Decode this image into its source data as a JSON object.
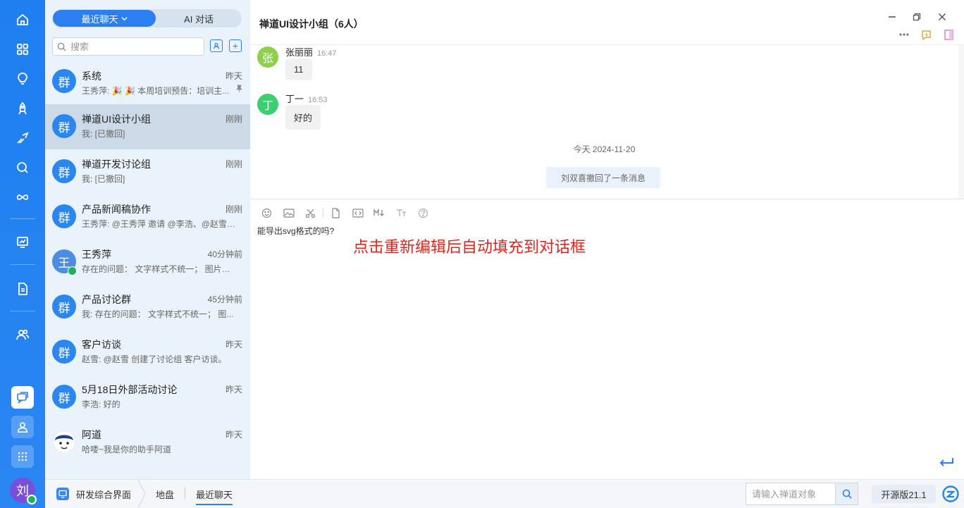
{
  "sidebar": {
    "icons": [
      "home-icon",
      "apps-grid-icon",
      "lightbulb-icon",
      "rocket-icon",
      "sprint-icon",
      "search-icon",
      "infinity-icon",
      "board-icon",
      "document-icon",
      "team-icon"
    ],
    "bottom": [
      "chat-icon",
      "contact-icon",
      "app-menu-icon"
    ],
    "user_avatar": "刘"
  },
  "list": {
    "tabs": {
      "recent": "最近聊天",
      "ai": "AI 对话"
    },
    "search_placeholder": "搜索",
    "items": [
      {
        "avatar": "群",
        "name": "系统",
        "time": "昨天",
        "preview": "王秀萍: 🎉 🎉 本周培训预告：培训主...",
        "pinned": true
      },
      {
        "avatar": "群",
        "name": "禅道UI设计小组",
        "time": "刚刚",
        "preview": "我: [已撤回]",
        "selected": true
      },
      {
        "avatar": "群",
        "name": "禅道开发讨论组",
        "time": "刚刚",
        "preview": "我: [已撤回]"
      },
      {
        "avatar": "群",
        "name": "产品新闻稿协作",
        "time": "刚刚",
        "preview": "王秀萍: @王秀萍 邀请 @李浩、@赵雪 ..."
      },
      {
        "avatar": "王",
        "name": "王秀萍",
        "time": "40分钟前",
        "preview": "存在的问题：  文字样式不统一；  图片大...",
        "online": true
      },
      {
        "avatar": "群",
        "name": "产品讨论群",
        "time": "45分钟前",
        "preview": "我: 存在的问题：  文字样式不统一；  图..."
      },
      {
        "avatar": "群",
        "name": "客户访谈",
        "time": "昨天",
        "preview": "赵雪: @赵雪 创建了讨论组 客户访谈。"
      },
      {
        "avatar": "群",
        "name": "5月18日外部活动讨论",
        "time": "昨天",
        "preview": "李浩: 好的"
      },
      {
        "avatar": "",
        "name": "阿道",
        "time": "昨天",
        "preview": "哈喽~我是你的助手阿道"
      }
    ]
  },
  "chat": {
    "title": "禅道UI设计小组（6人）",
    "messages": [
      {
        "avatar": "张",
        "avatar_color": "#8fcf4b",
        "sender": "张丽丽",
        "time": "16:47",
        "text": "11"
      },
      {
        "avatar": "丁",
        "avatar_color": "#3ccf72",
        "sender": "丁一",
        "time": "16:53",
        "text": "好的"
      }
    ],
    "date_divider": "今天 2024-11-20",
    "recall_notice": "刘双喜撤回了一条消息",
    "draft": "能导出svg格式的吗?",
    "annotation": "点击重新编辑后自动填充到对话框"
  },
  "status_bar": {
    "crumbs": [
      "研发综合界面",
      "地盘",
      "最近聊天"
    ],
    "search_placeholder": "请输入禅道对象",
    "version": "开源版21.1"
  }
}
